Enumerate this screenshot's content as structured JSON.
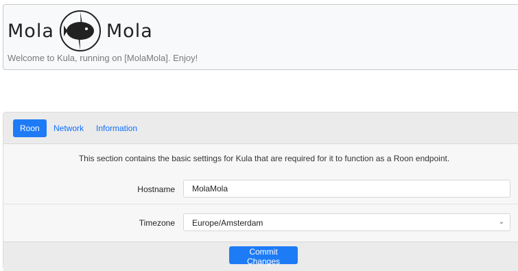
{
  "header": {
    "logo_left": "Mola",
    "logo_right": "Mola",
    "welcome": "Welcome to Kula, running on [MolaMola]. Enjoy!"
  },
  "tabs": [
    {
      "label": "Roon",
      "active": true
    },
    {
      "label": "Network",
      "active": false
    },
    {
      "label": "Information",
      "active": false
    }
  ],
  "roon": {
    "intro": "This section contains the basic settings for Kula that are required for it to function as a Roon endpoint.",
    "hostname_label": "Hostname",
    "hostname_value": "MolaMola",
    "timezone_label": "Timezone",
    "timezone_value": "Europe/Amsterdam"
  },
  "actions": {
    "commit_label": "Commit Changes"
  },
  "colors": {
    "accent": "#1e7bf6"
  }
}
